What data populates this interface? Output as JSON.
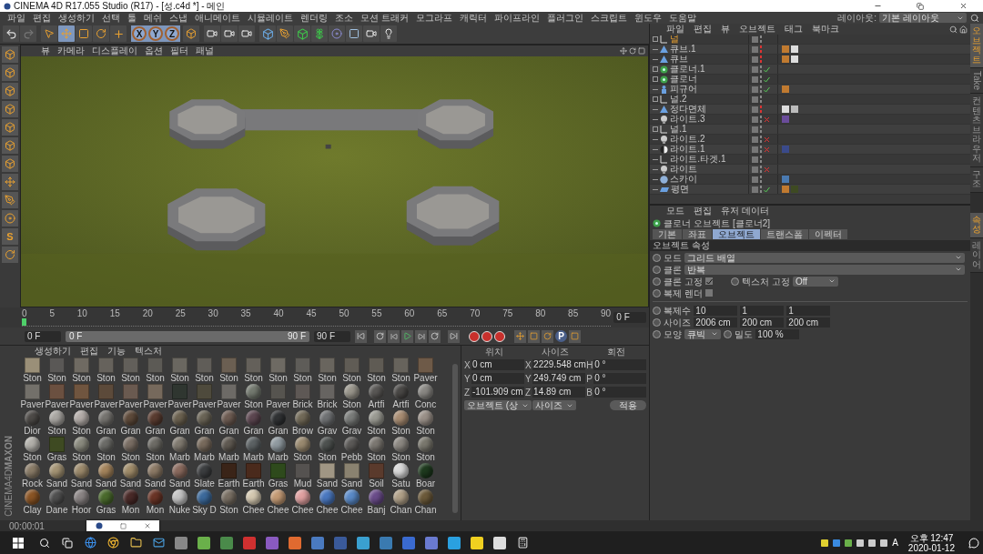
{
  "window": {
    "title": "CINEMA 4D R17.055 Studio (R17) - [성.c4d *] - 메인"
  },
  "menu": [
    "파일",
    "편집",
    "생성하기",
    "선택",
    "툴",
    "메쉬",
    "스냅",
    "애니메이트",
    "시뮬레이트",
    "렌더링",
    "조소",
    "모션 트래커",
    "모그라프",
    "캐릭터",
    "파이프라인",
    "플러그인",
    "스크립트",
    "윈도우",
    "도움말"
  ],
  "layout": {
    "label": "레이아웃:",
    "value": "기본 레이아웃"
  },
  "toolbar": {
    "tools": [
      {
        "kind": "select",
        "selected": false
      },
      {
        "kind": "move",
        "selected": true
      },
      {
        "kind": "scale",
        "selected": false
      },
      {
        "kind": "rotate",
        "selected": false
      }
    ],
    "axes": [
      {
        "label": "X",
        "selected": true
      },
      {
        "label": "Y",
        "selected": true
      },
      {
        "label": "Z",
        "selected": true
      }
    ]
  },
  "left_toolbar": {
    "snap_label": "S"
  },
  "viewport": {
    "menu": [
      "뷰",
      "카메라",
      "디스플레이",
      "옵션",
      "필터",
      "패널"
    ]
  },
  "timeline": {
    "ticks": [
      "0",
      "5",
      "10",
      "15",
      "20",
      "25",
      "30",
      "35",
      "40",
      "45",
      "50",
      "55",
      "60",
      "65",
      "70",
      "75",
      "80",
      "85",
      "90"
    ],
    "frame_field": "0 F",
    "level": 0
  },
  "transport": {
    "start_field": "0 F",
    "range_start": "0 F",
    "range_end": "90 F",
    "end_field": "90 F",
    "key_label": "P"
  },
  "materials": {
    "menu": [
      "생성하기",
      "편집",
      "기능",
      "텍스처"
    ],
    "logo": [
      "MAXON",
      "CINEMA4D"
    ],
    "items": [
      {
        "label": "Ston",
        "kind": "flat",
        "color": "#9a8f78"
      },
      {
        "label": "Ston",
        "kind": "flat",
        "color": "#5a5856"
      },
      {
        "label": "Ston",
        "kind": "flat",
        "color": "#6f6a62"
      },
      {
        "label": "Ston",
        "kind": "flat",
        "color": "#66625c"
      },
      {
        "label": "Ston",
        "kind": "flat",
        "color": "#625f5a"
      },
      {
        "label": "Ston",
        "kind": "flat",
        "color": "#5c5a55"
      },
      {
        "label": "Ston",
        "kind": "flat",
        "color": "#6a6760"
      },
      {
        "label": "Ston",
        "kind": "flat",
        "color": "#605d58"
      },
      {
        "label": "Ston",
        "kind": "flat",
        "color": "#6b5f52"
      },
      {
        "label": "Ston",
        "kind": "flat",
        "color": "#64605a"
      },
      {
        "label": "Ston",
        "kind": "flat",
        "color": "#6e6a63"
      },
      {
        "label": "Ston",
        "kind": "flat",
        "color": "#5e5c58"
      },
      {
        "label": "Ston",
        "kind": "flat",
        "color": "#69655e"
      },
      {
        "label": "Ston",
        "kind": "flat",
        "color": "#605c55"
      },
      {
        "label": "Ston",
        "kind": "flat",
        "color": "#5f5b54"
      },
      {
        "label": "Ston",
        "kind": "flat",
        "color": "#67635c"
      },
      {
        "label": "Paver",
        "kind": "flat",
        "color": "#6e5a48"
      },
      {
        "label": "Paver",
        "kind": "flat",
        "color": "#73706a"
      },
      {
        "label": "Paver",
        "kind": "flat",
        "color": "#6b5040"
      },
      {
        "label": "Paver",
        "kind": "flat",
        "color": "#70553f"
      },
      {
        "label": "Paver",
        "kind": "flat",
        "color": "#5c4a3a"
      },
      {
        "label": "Paver",
        "kind": "flat",
        "color": "#6a5a50"
      },
      {
        "label": "Paver",
        "kind": "flat",
        "color": "#76695c"
      },
      {
        "label": "Paver",
        "kind": "flat",
        "color": "#2f3630"
      },
      {
        "label": "Paver",
        "kind": "flat",
        "color": "#4e4a3c"
      },
      {
        "label": "Paver",
        "kind": "flat",
        "color": "#6d6a66"
      },
      {
        "label": "Ston",
        "kind": "sphere",
        "color": "#747a70"
      },
      {
        "label": "Paver",
        "kind": "flat",
        "color": "#56544f"
      },
      {
        "label": "Brick",
        "kind": "flat",
        "color": "#5e5855"
      },
      {
        "label": "Brick",
        "kind": "flat",
        "color": "#676461"
      },
      {
        "label": "Ston",
        "kind": "sphere",
        "color": "#9a968c"
      },
      {
        "label": "Artfi",
        "kind": "sphere",
        "color": "#5a5856"
      },
      {
        "label": "Artfi",
        "kind": "sphere",
        "color": "#4a4846"
      },
      {
        "label": "Conc",
        "kind": "sphere",
        "color": "#8a8884"
      },
      {
        "label": "Dior",
        "kind": "sphere",
        "color": "#4d4a47"
      },
      {
        "label": "Ston",
        "kind": "sphere",
        "color": "#a9a6a2"
      },
      {
        "label": "Ston",
        "kind": "sphere",
        "color": "#b3aca8"
      },
      {
        "label": "Gran",
        "kind": "sphere",
        "color": "#767470"
      },
      {
        "label": "Gran",
        "kind": "sphere",
        "color": "#5e4a3a"
      },
      {
        "label": "Gran",
        "kind": "sphere",
        "color": "#5a3c30"
      },
      {
        "label": "Gran",
        "kind": "sphere",
        "color": "#6c6250"
      },
      {
        "label": "Gran",
        "kind": "sphere",
        "color": "#6a6456"
      },
      {
        "label": "Gran",
        "kind": "sphere",
        "color": "#6e5c52"
      },
      {
        "label": "Gran",
        "kind": "sphere",
        "color": "#5c4650"
      },
      {
        "label": "Gran",
        "kind": "sphere",
        "color": "#303234"
      },
      {
        "label": "Brow",
        "kind": "sphere",
        "color": "#726a58"
      },
      {
        "label": "Grav",
        "kind": "sphere",
        "color": "#707274"
      },
      {
        "label": "Grav",
        "kind": "sphere",
        "color": "#7a7c7a"
      },
      {
        "label": "Ston",
        "kind": "sphere",
        "color": "#9a9a92"
      },
      {
        "label": "Ston",
        "kind": "sphere",
        "color": "#a88c72"
      },
      {
        "label": "Ston",
        "kind": "sphere",
        "color": "#9a9088"
      },
      {
        "label": "Ston",
        "kind": "sphere",
        "color": "#b2b0aa"
      },
      {
        "label": "Gras",
        "kind": "flat",
        "color": "#3e4a22"
      },
      {
        "label": "Ston",
        "kind": "sphere",
        "color": "#8a8a7e"
      },
      {
        "label": "Ston",
        "kind": "sphere",
        "color": "#6c6c68"
      },
      {
        "label": "Ston",
        "kind": "sphere",
        "color": "#7a6e64"
      },
      {
        "label": "Ston",
        "kind": "sphere",
        "color": "#6e6c66"
      },
      {
        "label": "Marb",
        "kind": "sphere",
        "color": "#807a70"
      },
      {
        "label": "Marb",
        "kind": "sphere",
        "color": "#786a5c"
      },
      {
        "label": "Marb",
        "kind": "sphere",
        "color": "#605a52"
      },
      {
        "label": "Marb",
        "kind": "sphere",
        "color": "#5c6264"
      },
      {
        "label": "Marb",
        "kind": "sphere",
        "color": "#909aa0"
      },
      {
        "label": "Ston",
        "kind": "sphere",
        "color": "#9a8a70"
      },
      {
        "label": "Ston",
        "kind": "sphere",
        "color": "#4e5250"
      },
      {
        "label": "Pebb",
        "kind": "sphere",
        "color": "#5c5a58"
      },
      {
        "label": "Ston",
        "kind": "sphere",
        "color": "#7c7872"
      },
      {
        "label": "Ston",
        "kind": "sphere",
        "color": "#8c8882"
      },
      {
        "label": "Ston",
        "kind": "sphere",
        "color": "#7a786e"
      },
      {
        "label": "Rock",
        "kind": "sphere",
        "color": "#8a7c68"
      },
      {
        "label": "Sand",
        "kind": "sphere",
        "color": "#a49474"
      },
      {
        "label": "Sand",
        "kind": "sphere",
        "color": "#9c8a6c"
      },
      {
        "label": "Sand",
        "kind": "sphere",
        "color": "#a4845c"
      },
      {
        "label": "Sand",
        "kind": "sphere",
        "color": "#a08c6a"
      },
      {
        "label": "Sand",
        "kind": "sphere",
        "color": "#8c7a66"
      },
      {
        "label": "Sand",
        "kind": "sphere",
        "color": "#8a6a5e"
      },
      {
        "label": "Slate",
        "kind": "sphere",
        "color": "#3c3e40"
      },
      {
        "label": "Earth",
        "kind": "flat",
        "color": "#3a2418"
      },
      {
        "label": "Earth",
        "kind": "flat",
        "color": "#4a2a1c"
      },
      {
        "label": "Gras",
        "kind": "flat",
        "color": "#2e4a1c"
      },
      {
        "label": "Mud",
        "kind": "flat",
        "color": "#555250"
      },
      {
        "label": "Sand",
        "kind": "flat",
        "color": "#a09684"
      },
      {
        "label": "Sand",
        "kind": "flat",
        "color": "#8a8270"
      },
      {
        "label": "Soil",
        "kind": "flat",
        "color": "#5a3a2c"
      },
      {
        "label": "Satu",
        "kind": "sphere",
        "color": "#d8d8d8"
      },
      {
        "label": "Boar",
        "kind": "sphere",
        "color": "#1e3a1e"
      },
      {
        "label": "Clay",
        "kind": "sphere",
        "color": "#8a5424"
      },
      {
        "label": "Dane",
        "kind": "sphere",
        "color": "#505050"
      },
      {
        "label": "Hoor",
        "kind": "sphere",
        "color": "#8a8484"
      },
      {
        "label": "Gras",
        "kind": "sphere",
        "color": "#4a6a2c"
      },
      {
        "label": "Mon",
        "kind": "sphere",
        "color": "#4a2a28"
      },
      {
        "label": "Mon",
        "kind": "sphere",
        "color": "#6a3426"
      },
      {
        "label": "Nuke",
        "kind": "sphere",
        "color": "#c4c4c4"
      },
      {
        "label": "Sky D",
        "kind": "sphere",
        "color": "#3c6a9c"
      },
      {
        "label": "Ston",
        "kind": "sphere",
        "color": "#7a7064"
      },
      {
        "label": "Chee",
        "kind": "sphere",
        "color": "#d4c8b0"
      },
      {
        "label": "Chee",
        "kind": "sphere",
        "color": "#c49a74"
      },
      {
        "label": "Chee",
        "kind": "sphere",
        "color": "#e0a0a0"
      },
      {
        "label": "Chee",
        "kind": "sphere",
        "color": "#4a78c0"
      },
      {
        "label": "Chee",
        "kind": "sphere",
        "color": "#5a8ac8"
      },
      {
        "label": "Banj",
        "kind": "sphere",
        "color": "#6a4c8a"
      },
      {
        "label": "Chan",
        "kind": "sphere",
        "color": "#b0a088"
      },
      {
        "label": "Chan",
        "kind": "sphere",
        "color": "#6c5a3a"
      }
    ]
  },
  "coordinates": {
    "headers": [
      "위치",
      "사이즈",
      "회전"
    ],
    "rows": [
      {
        "axis": "X",
        "position": "0 cm",
        "size_axis": "X",
        "size": "2229.548 cm",
        "rot_axis": "H",
        "rotation": "0 °"
      },
      {
        "axis": "Y",
        "position": "0 cm",
        "size_axis": "Y",
        "size": "249.749 cm",
        "rot_axis": "P",
        "rotation": "0 °"
      },
      {
        "axis": "Z",
        "position": "-101.909 cm",
        "size_axis": "Z",
        "size": "14.89 cm",
        "rot_axis": "B",
        "rotation": "0 °"
      }
    ],
    "dropdowns": [
      "오브젝트 (상",
      "사이즈"
    ],
    "apply": "적용"
  },
  "objects": {
    "menu": [
      "파일",
      "편집",
      "뷰",
      "오브젝트",
      "태그",
      "북마크"
    ],
    "items": [
      {
        "name": "널",
        "kind": "null",
        "expandable": true,
        "selected": true,
        "locked": false
      },
      {
        "name": "큐브.1",
        "kind": "polygon",
        "expandable": false,
        "selected": false,
        "locked": true,
        "tags": [
          {
            "kind": "phong"
          },
          {
            "kind": "texture"
          }
        ]
      },
      {
        "name": "큐브",
        "kind": "polygon",
        "expandable": false,
        "selected": false,
        "locked": true,
        "tags": [
          {
            "kind": "phong"
          },
          {
            "kind": "texture"
          }
        ]
      },
      {
        "name": "클로너.1",
        "kind": "cloner",
        "expandable": true,
        "selected": false,
        "locked": false,
        "enabled": true
      },
      {
        "name": "클로너",
        "kind": "cloner",
        "expandable": true,
        "selected": false,
        "locked": false,
        "enabled": true
      },
      {
        "name": "피규어",
        "kind": "figure",
        "expandable": false,
        "selected": false,
        "locked": false,
        "enabled": true,
        "tags": [
          {
            "kind": "phong"
          }
        ]
      },
      {
        "name": "널.2",
        "kind": "null",
        "expandable": true,
        "selected": false,
        "locked": false
      },
      {
        "name": "정다면체",
        "kind": "polygon",
        "expandable": false,
        "selected": false,
        "locked": true,
        "tags": [
          {
            "kind": "texture"
          },
          {
            "kind": "material"
          }
        ]
      },
      {
        "name": "라이트.3",
        "kind": "light",
        "expandable": false,
        "selected": false,
        "locked": false,
        "enabled": false,
        "tags": [
          {
            "kind": "glow"
          }
        ]
      },
      {
        "name": "널.1",
        "kind": "null",
        "expandable": true,
        "selected": false,
        "locked": false
      },
      {
        "name": "라이트.2",
        "kind": "light",
        "expandable": false,
        "selected": false,
        "locked": false,
        "enabled": false
      },
      {
        "name": "라이트.1",
        "kind": "spot",
        "expandable": false,
        "selected": false,
        "locked": false,
        "enabled": false,
        "tags": [
          {
            "kind": "target"
          }
        ]
      },
      {
        "name": "라이트.타겟.1",
        "kind": "null",
        "expandable": false,
        "selected": false,
        "locked": false
      },
      {
        "name": "라이트",
        "kind": "light",
        "expandable": false,
        "selected": false,
        "locked": false,
        "enabled": false
      },
      {
        "name": "스카이",
        "kind": "sky",
        "expandable": false,
        "selected": false,
        "locked": false,
        "tags": [
          {
            "kind": "sky"
          }
        ]
      },
      {
        "name": "평면",
        "kind": "plane",
        "expandable": false,
        "selected": false,
        "locked": false,
        "enabled": true,
        "tags": [
          {
            "kind": "phong"
          },
          {
            "kind": "grass"
          }
        ]
      }
    ]
  },
  "attributes": {
    "menu": [
      "모드",
      "편집",
      "유저 데이터"
    ],
    "title": "클로너 오브젝트 [클로너2]",
    "tabs": [
      {
        "label": "기본",
        "selected": false
      },
      {
        "label": "좌표",
        "selected": false
      },
      {
        "label": "오브젝트",
        "selected": true
      },
      {
        "label": "트랜스폼",
        "selected": false
      },
      {
        "label": "이펙터",
        "selected": false
      }
    ],
    "section": "오브젝트 속성",
    "fields": [
      {
        "kind": "dropdown",
        "label": "모드",
        "value": "그리드 배열",
        "animated": false
      },
      {
        "kind": "dropdown",
        "label": "클론",
        "value": "반복",
        "animated": false
      },
      {
        "kind": "check-pair",
        "label": "클론 고정",
        "checked": true,
        "animated": false,
        "second_label": "텍스처 고정",
        "second_value": "Off",
        "second_animated": false
      },
      {
        "kind": "check",
        "label": "복제 렌더",
        "checked": false,
        "animated": false
      },
      {
        "kind": "rule"
      },
      {
        "kind": "triple",
        "label": "복제수",
        "values": [
          "10",
          "1",
          "1"
        ],
        "animated": false
      },
      {
        "kind": "triple",
        "label": "사이즈",
        "values": [
          "2006 cm",
          "200 cm",
          "200 cm"
        ],
        "animated": false
      },
      {
        "kind": "shape",
        "label": "모양",
        "value": "큐빅",
        "animated": false,
        "second_label": "밀도",
        "second_value": "100 %",
        "second_animated": false
      }
    ]
  },
  "side_tabs_top": [
    {
      "label": "오브젝트",
      "selected": true
    },
    {
      "label": "Take",
      "selected": false
    },
    {
      "label": "컨텐츠 브라우저",
      "selected": false
    },
    {
      "label": "구조",
      "selected": false
    }
  ],
  "side_tabs_bottom": [
    {
      "label": "속성",
      "selected": true
    },
    {
      "label": "레이어",
      "selected": false
    }
  ],
  "status_bar": {
    "time": "00:00:01"
  },
  "taskbar": {
    "ime": "A",
    "time": "오후 12:47",
    "date": "2020-01-12"
  }
}
